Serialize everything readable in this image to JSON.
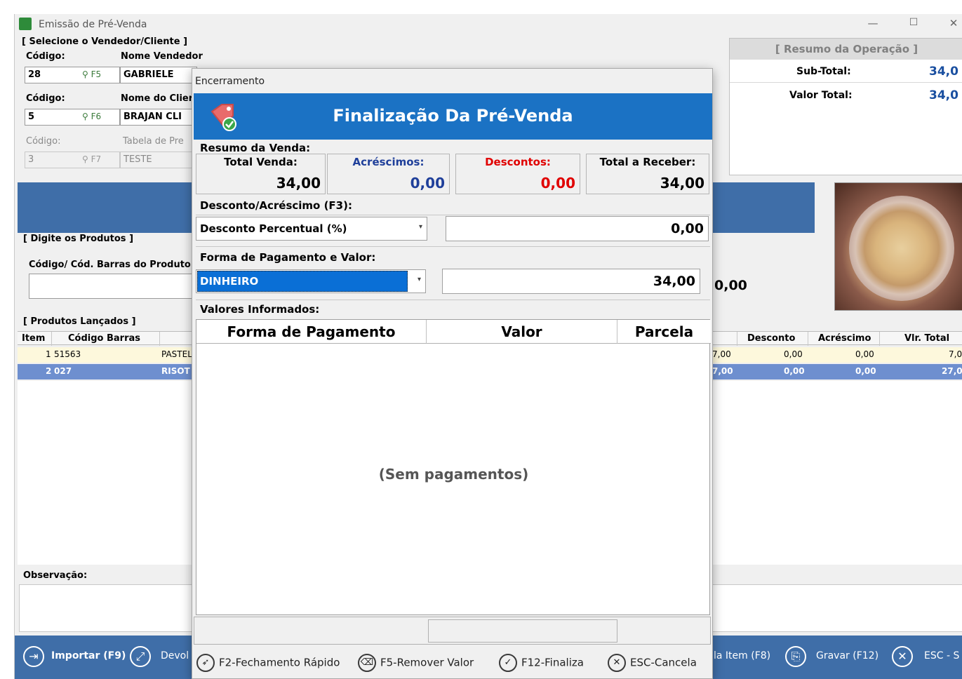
{
  "window": {
    "title": "Emissão de Pré-Venda",
    "minimize": "—",
    "maximize": "☐",
    "close": "✕"
  },
  "selecao": {
    "group_title": "[ Selecione o Vendedor/Cliente ]",
    "vendedor": {
      "code_label": "Código:",
      "name_label": "Nome Vendedor",
      "code": "28",
      "key": "F5",
      "name": "GABRIELE"
    },
    "cliente": {
      "code_label": "Código:",
      "name_label": "Nome do Clier",
      "code": "5",
      "key": "F6",
      "name": "BRAJAN CLI"
    },
    "tabela": {
      "code_label": "Código:",
      "name_label": "Tabela de Pre",
      "code": "3",
      "key": "F7",
      "name": "TESTE"
    }
  },
  "resumo": {
    "title": "[ Resumo da Operação ]",
    "subtotal_label": "Sub-Total:",
    "subtotal_value": "34,0",
    "total_label": "Valor Total:",
    "total_value": "34,0"
  },
  "produtos": {
    "group_title": "[ Digite os Produtos ]",
    "code_label": "Código/ Cód. Barras do Produto",
    "behind_value": "0,00"
  },
  "lancados": {
    "group_title": "[ Produtos Lançados ]",
    "columns": [
      "Item",
      "Código Barras",
      "Desconto",
      "Acréscimo",
      "Vlr. Total"
    ],
    "rows": [
      {
        "item": "1",
        "barcode": "51563",
        "desc_trunc": "PASTEL",
        "qty_trunc": "7,00",
        "desconto": "0,00",
        "acrescimo": "0,00",
        "total": "7,0"
      },
      {
        "item": "2",
        "barcode": "027",
        "desc_trunc": "RISOT",
        "qty_trunc": "7,00",
        "desconto": "0,00",
        "acrescimo": "0,00",
        "total": "27,0"
      }
    ]
  },
  "observacao": {
    "label": "Observação:"
  },
  "toolbar": {
    "importar": "Importar (F9)",
    "devolucao": "Devol",
    "item": "la Item (F8)",
    "gravar": "Gravar (F12)",
    "esc": "ESC - S"
  },
  "dialog": {
    "title": "Encerramento",
    "header": "Finalização Da Pré-Venda",
    "resumo_label": "Resumo da Venda:",
    "boxes": {
      "total_venda_label": "Total Venda:",
      "total_venda": "34,00",
      "acrescimos_label": "Acréscimos:",
      "acrescimos": "0,00",
      "descontos_label": "Descontos:",
      "descontos": "0,00",
      "total_receber_label": "Total a Receber:",
      "total_receber": "34,00"
    },
    "desconto_label": "Desconto/Acréscimo (F3):",
    "desconto_tipo": "Desconto Percentual (%)",
    "desconto_valor": "0,00",
    "pagamento_label": "Forma de Pagamento e Valor:",
    "pagamento_forma": "DINHEIRO",
    "pagamento_valor": "34,00",
    "informados_label": "Valores Informados:",
    "table_columns": [
      "Forma de Pagamento",
      "Valor",
      "Parcela"
    ],
    "empty_text": "(Sem  pagamentos)",
    "buttons": {
      "fechamento": "F2-Fechamento Rápido",
      "remover": "F5-Remover Valor",
      "finaliza": "F12-Finaliza",
      "cancela": "ESC-Cancela"
    }
  },
  "colors": {
    "toolbar_blue": "#3f6ea8",
    "dialog_header_blue": "#1b72c4",
    "selected_row": "#6e8fcf",
    "highlight_row": "#fdf8dc",
    "resumo_value": "#1a4fa0",
    "acrescimos": "#1f3f9a",
    "descontos": "#e00000"
  }
}
